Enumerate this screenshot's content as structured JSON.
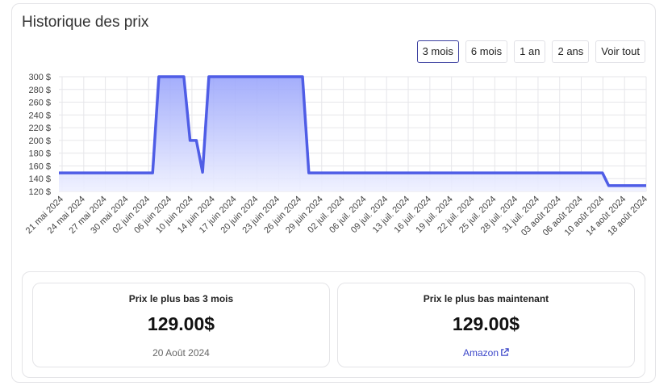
{
  "title": "Historique des prix",
  "ranges": [
    {
      "label": "3 mois",
      "active": true
    },
    {
      "label": "6 mois",
      "active": false
    },
    {
      "label": "1 an",
      "active": false
    },
    {
      "label": "2 ans",
      "active": false
    },
    {
      "label": "Voir tout",
      "active": false
    }
  ],
  "colors": {
    "line": "#4f5de6",
    "fill_top": "#9aa5fb",
    "fill_bottom": "#eef0ff",
    "grid": "#e6e6ea",
    "active_border": "#3b3fa0",
    "link": "#3c47c9"
  },
  "chart_data": {
    "type": "area",
    "x_tick_labels": [
      "21 mai 2024",
      "24 mai 2024",
      "27 mai 2024",
      "30 mai 2024",
      "02 juin 2024",
      "06 juin 2024",
      "10 juin 2024",
      "14 juin 2024",
      "17 juin 2024",
      "20 juin 2024",
      "23 juin 2024",
      "26 juin 2024",
      "29 juin 2024",
      "02 juil. 2024",
      "06 juil. 2024",
      "09 juil. 2024",
      "13 juil. 2024",
      "16 juil. 2024",
      "19 juil. 2024",
      "22 juil. 2024",
      "25 juil. 2024",
      "28 juil. 2024",
      "31 juil. 2024",
      "03 août 2024",
      "06 août 2024",
      "10 août 2024",
      "14 août 2024",
      "18 août 2024"
    ],
    "y_tick_labels": [
      "300 $",
      "280 $",
      "260 $",
      "240 $",
      "220 $",
      "200 $",
      "180 $",
      "160 $",
      "140 $",
      "120 $"
    ],
    "ylim": [
      120,
      300
    ],
    "grid": true,
    "series": [
      {
        "points": [
          [
            "2024-05-19",
            149
          ],
          [
            "2024-06-03",
            149
          ],
          [
            "2024-06-04",
            300
          ],
          [
            "2024-06-08",
            300
          ],
          [
            "2024-06-09",
            200
          ],
          [
            "2024-06-10",
            200
          ],
          [
            "2024-06-11",
            150
          ],
          [
            "2024-06-12",
            300
          ],
          [
            "2024-06-27",
            300
          ],
          [
            "2024-06-28",
            149
          ],
          [
            "2024-08-14",
            149
          ],
          [
            "2024-08-15",
            129
          ],
          [
            "2024-08-21",
            129
          ]
        ]
      }
    ]
  },
  "stats": [
    {
      "label": "Prix le plus bas 3 mois",
      "value": "129.00$",
      "sub": "20 Août 2024"
    },
    {
      "label": "Prix le plus bas maintenant",
      "value": "129.00$",
      "link": "Amazon"
    }
  ]
}
